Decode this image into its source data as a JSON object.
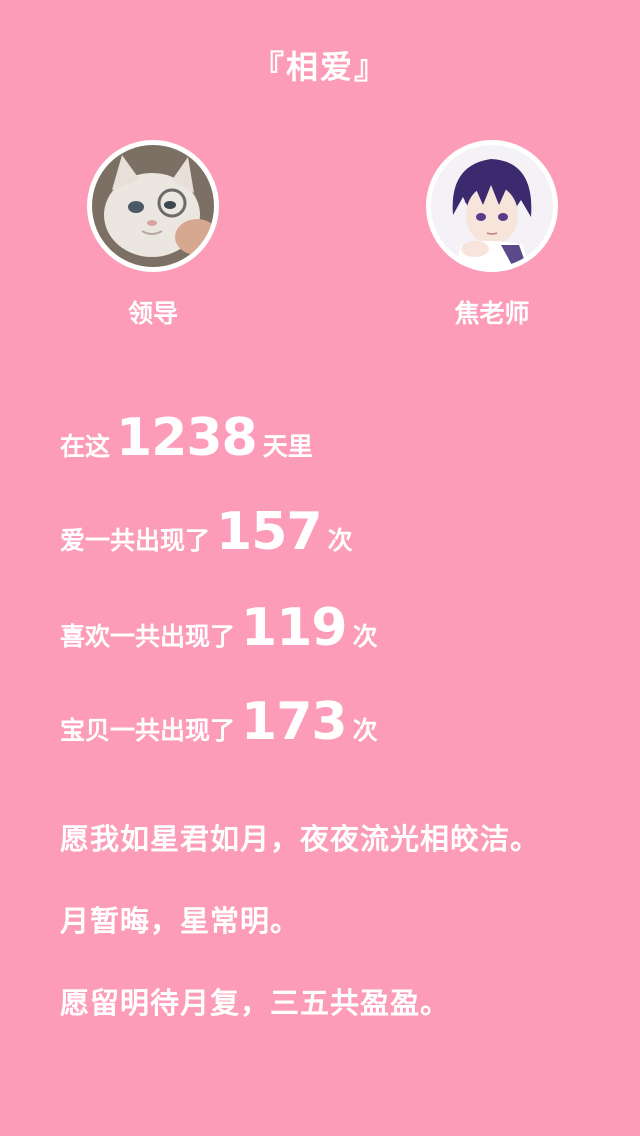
{
  "title": "『相爱』",
  "people": [
    {
      "name": "领导",
      "avatar_icon": "cat-avatar-icon"
    },
    {
      "name": "焦老师",
      "avatar_icon": "anime-boy-avatar-icon"
    }
  ],
  "stats": [
    {
      "prefix": "在这",
      "value": "1238",
      "suffix": "天里"
    },
    {
      "prefix": "爱一共出现了",
      "value": "157",
      "suffix": "次"
    },
    {
      "prefix": "喜欢一共出现了",
      "value": "119",
      "suffix": "次"
    },
    {
      "prefix": "宝贝一共出现了",
      "value": "173",
      "suffix": "次"
    }
  ],
  "poem": [
    "愿我如星君如月，夜夜流光相皎洁。",
    "月暂晦，星常明。",
    "愿留明待月复，三五共盈盈。"
  ],
  "colors": {
    "background": "#fd9cb9",
    "text": "#ffffff"
  }
}
